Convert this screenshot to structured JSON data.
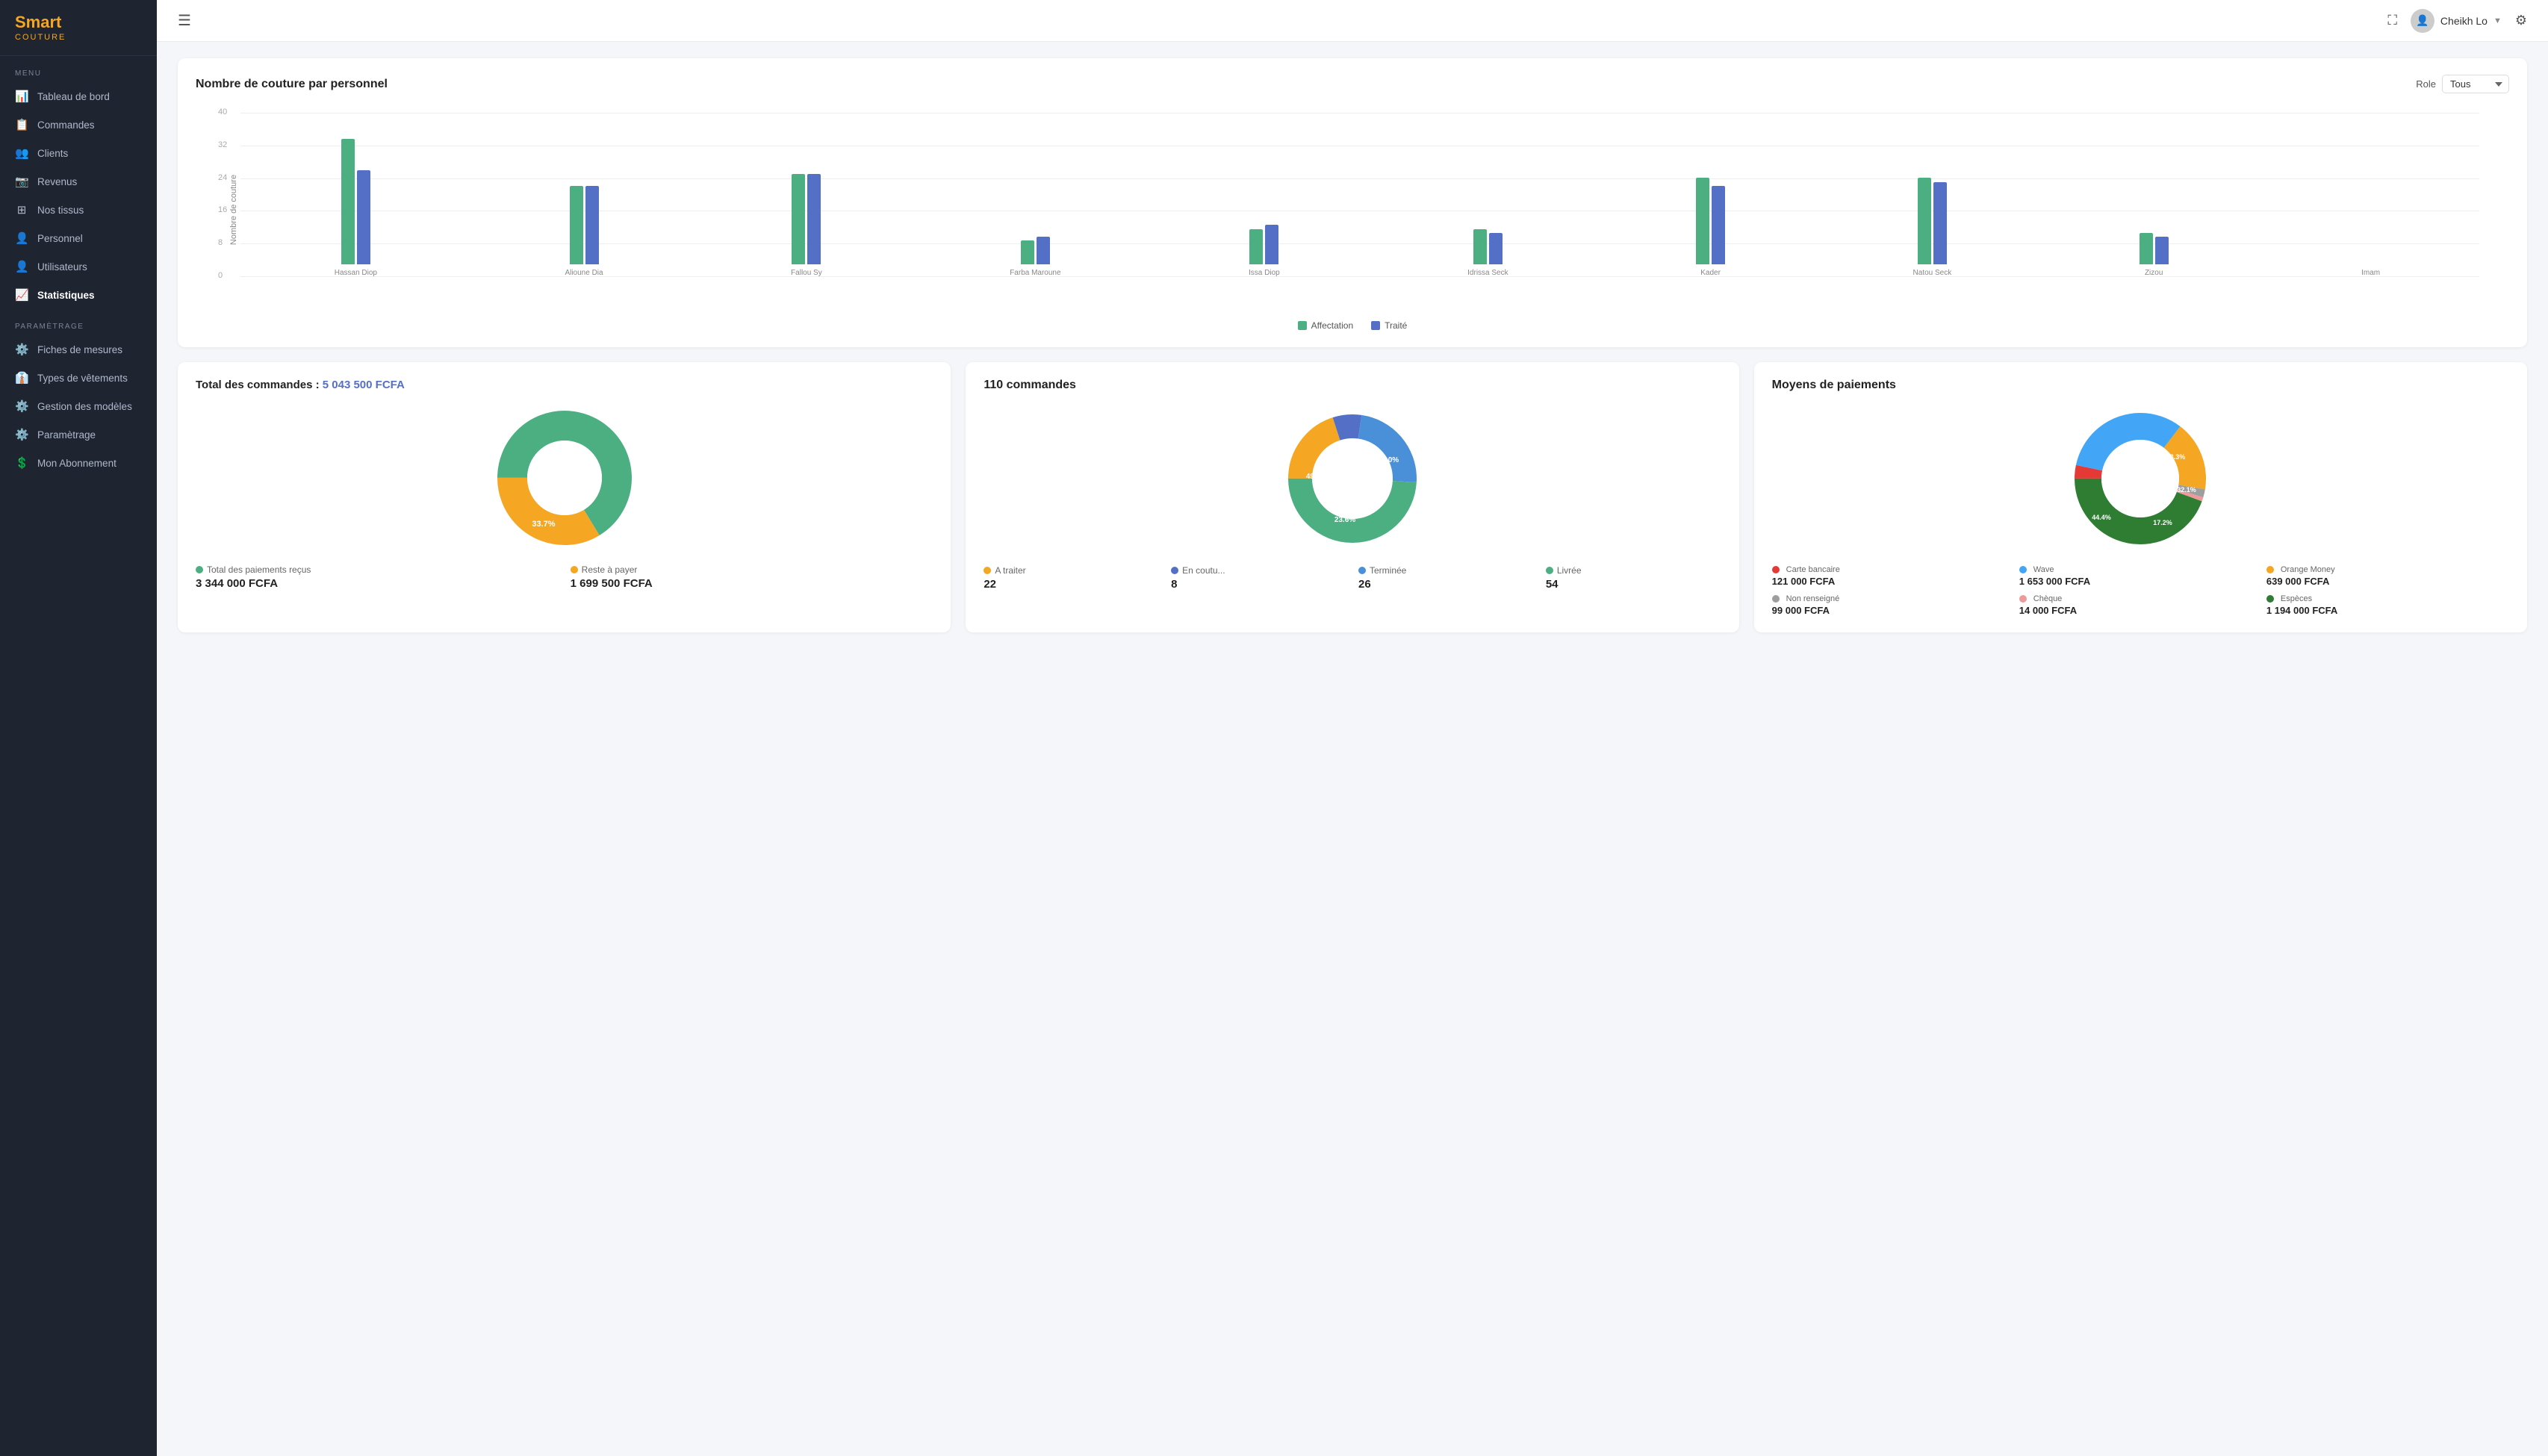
{
  "app": {
    "name_line1": "Smart",
    "name_line2": "COUTURE",
    "tagline": "COUTURE"
  },
  "sidebar": {
    "menu_label": "MENU",
    "parametrage_label": "PARAMÈTRAGE",
    "items": [
      {
        "id": "tableau",
        "label": "Tableau de bord",
        "icon": "📊",
        "active": false
      },
      {
        "id": "commandes",
        "label": "Commandes",
        "icon": "📋",
        "active": false
      },
      {
        "id": "clients",
        "label": "Clients",
        "icon": "👥",
        "active": false
      },
      {
        "id": "revenus",
        "label": "Revenus",
        "icon": "📷",
        "active": false
      },
      {
        "id": "tissus",
        "label": "Nos tissus",
        "icon": "⊞",
        "active": false
      },
      {
        "id": "personnel",
        "label": "Personnel",
        "icon": "👤",
        "active": false
      },
      {
        "id": "utilisateurs",
        "label": "Utilisateurs",
        "icon": "👤",
        "active": false
      },
      {
        "id": "statistiques",
        "label": "Statistiques",
        "icon": "📈",
        "active": true
      }
    ],
    "param_items": [
      {
        "id": "mesures",
        "label": "Fiches de mesures",
        "icon": "⚙️"
      },
      {
        "id": "vetements",
        "label": "Types de vêtements",
        "icon": "👔"
      },
      {
        "id": "modeles",
        "label": "Gestion des modèles",
        "icon": "⚙️"
      },
      {
        "id": "parametrage",
        "label": "Paramètrage",
        "icon": "⚙️"
      },
      {
        "id": "abonnement",
        "label": "Mon Abonnement",
        "icon": "💲"
      }
    ]
  },
  "topbar": {
    "user_name": "Cheikh Lo",
    "hamburger_label": "≡"
  },
  "bar_chart": {
    "title": "Nombre de couture par personnel",
    "y_label": "Nombre de couture",
    "role_label": "Role",
    "role_value": "Tous",
    "y_ticks": [
      0,
      8,
      16,
      24,
      32,
      40
    ],
    "max_val": 40,
    "legend": [
      {
        "label": "Affectation",
        "color": "#4caf82"
      },
      {
        "label": "Traité",
        "color": "#5470c6"
      }
    ],
    "bars": [
      {
        "name": "Hassan Diop",
        "affectation": 32,
        "traite": 24
      },
      {
        "name": "Alioune Dia",
        "affectation": 20,
        "traite": 20
      },
      {
        "name": "Fallou Sy",
        "affectation": 23,
        "traite": 23
      },
      {
        "name": "Farba Maroune",
        "affectation": 6,
        "traite": 7
      },
      {
        "name": "Issa Diop",
        "affectation": 9,
        "traite": 10
      },
      {
        "name": "Idrissa Seck",
        "affectation": 9,
        "traite": 8
      },
      {
        "name": "Kader",
        "affectation": 22,
        "traite": 20
      },
      {
        "name": "Natou Seck",
        "affectation": 22,
        "traite": 21
      },
      {
        "name": "Zizou",
        "affectation": 8,
        "traite": 7
      },
      {
        "name": "Imam",
        "affectation": 0,
        "traite": 0
      }
    ]
  },
  "total_commandes": {
    "title": "Total des commandes :",
    "amount": "5 043 500 FCFA",
    "amount_raw": 5043500,
    "donut": {
      "segments": [
        {
          "label": "Total des paiements reçus",
          "value": 66.3,
          "color": "#4caf82",
          "dot_color": "#4caf82"
        },
        {
          "label": "Reste à payer",
          "value": 33.7,
          "color": "#f5a623",
          "dot_color": "#f5a623"
        }
      ]
    },
    "stats": [
      {
        "label": "Total des paiements reçus",
        "color": "#4caf82",
        "value": "3 344 000 FCFA"
      },
      {
        "label": "Reste à payer",
        "color": "#f5a623",
        "value": "1 699 500 FCFA"
      }
    ]
  },
  "commandes_status": {
    "title": "110 commandes",
    "donut": {
      "segments": [
        {
          "label": "A traiter",
          "value": 20.0,
          "color": "#f5a623",
          "dot_color": "#f5a623"
        },
        {
          "label": "En coutu...",
          "value": 7.3,
          "color": "#5470c6",
          "dot_color": "#5470c6"
        },
        {
          "label": "Terminée",
          "value": 23.6,
          "color": "#4a90d9",
          "dot_color": "#4a90d9"
        },
        {
          "label": "Livrée",
          "value": 49.1,
          "color": "#4caf82",
          "dot_color": "#4caf82"
        }
      ]
    },
    "stats": [
      {
        "label": "A traiter",
        "color": "#f5a623",
        "value": "22"
      },
      {
        "label": "En coutu...",
        "color": "#5470c6",
        "value": "8"
      },
      {
        "label": "Terminée",
        "color": "#4a90d9",
        "value": "26"
      },
      {
        "label": "Livrée",
        "color": "#4caf82",
        "value": "54"
      }
    ]
  },
  "moyens_paiements": {
    "title": "Moyens de paiements",
    "donut": {
      "segments": [
        {
          "label": "Carte bancaire",
          "value": 3.3,
          "color": "#e53935",
          "dot_color": "#e53935"
        },
        {
          "label": "Wave",
          "value": 32.1,
          "color": "#42a5f5",
          "dot_color": "#42a5f5"
        },
        {
          "label": "Orange Money",
          "value": 17.2,
          "color": "#f5a623",
          "dot_color": "#f5a623"
        },
        {
          "label": "Non renseigné",
          "value": 2.0,
          "color": "#9e9e9e",
          "dot_color": "#9e9e9e"
        },
        {
          "label": "Chèque",
          "value": 1.0,
          "color": "#ef9a9a",
          "dot_color": "#ef9a9a"
        },
        {
          "label": "Espèces",
          "value": 44.4,
          "color": "#2e7d32",
          "dot_color": "#2e7d32"
        }
      ]
    },
    "payments": [
      {
        "label": "Carte bancaire",
        "color": "#e53935",
        "value": "121 000 FCFA"
      },
      {
        "label": "Wave",
        "color": "#42a5f5",
        "value": "1 653 000 FCFA"
      },
      {
        "label": "Orange Money",
        "color": "#f5a623",
        "value": "639 000 FCFA"
      },
      {
        "label": "Non renseigné",
        "color": "#9e9e9e",
        "value": "99 000 FCFA"
      },
      {
        "label": "Chèque",
        "color": "#ef9a9a",
        "value": "14 000 FCFA"
      },
      {
        "label": "Espèces",
        "color": "#2e7d32",
        "value": "1 194 000 FCFA"
      }
    ]
  }
}
